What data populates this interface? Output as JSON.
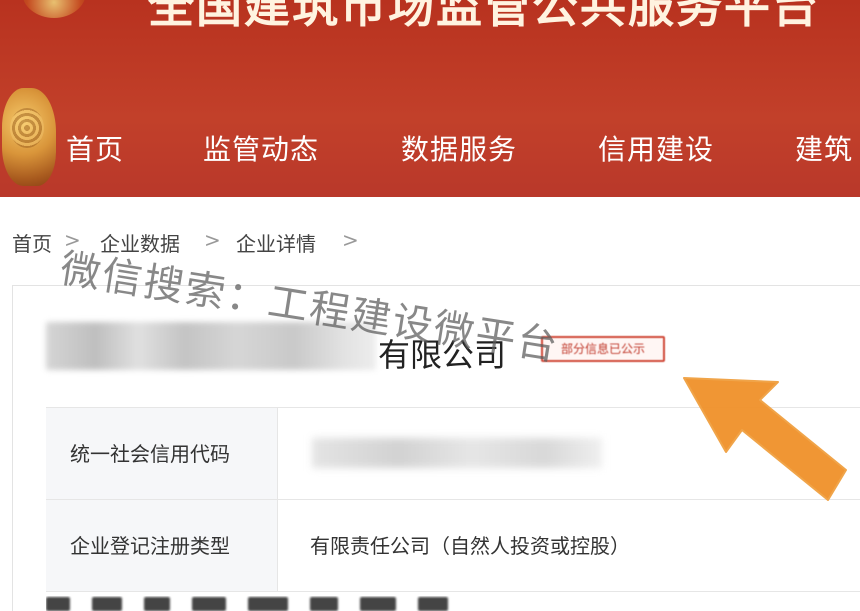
{
  "header": {
    "site_title": "全国建筑市场监管公共服务平台",
    "nav": [
      {
        "label": "首页"
      },
      {
        "label": "监管动态"
      },
      {
        "label": "数据服务"
      },
      {
        "label": "信用建设"
      },
      {
        "label": "建筑"
      }
    ]
  },
  "breadcrumb": {
    "items": [
      "首页",
      "企业数据",
      "企业详情"
    ],
    "separator": ">"
  },
  "company": {
    "name_suffix": "有限公司",
    "badge": "部分信息已公示"
  },
  "details": {
    "rows": [
      {
        "label": "统一社会信用代码",
        "value": ""
      },
      {
        "label": "企业登记注册类型",
        "value": "有限责任公司（自然人投资或控股）"
      }
    ]
  },
  "watermark": {
    "text": "微信搜索：工程建设微平台"
  },
  "colors": {
    "header_red": "#b8321f",
    "arrow_orange": "#f0912a",
    "badge_red": "#d04a3a",
    "label_bg": "#f6f7f9"
  }
}
